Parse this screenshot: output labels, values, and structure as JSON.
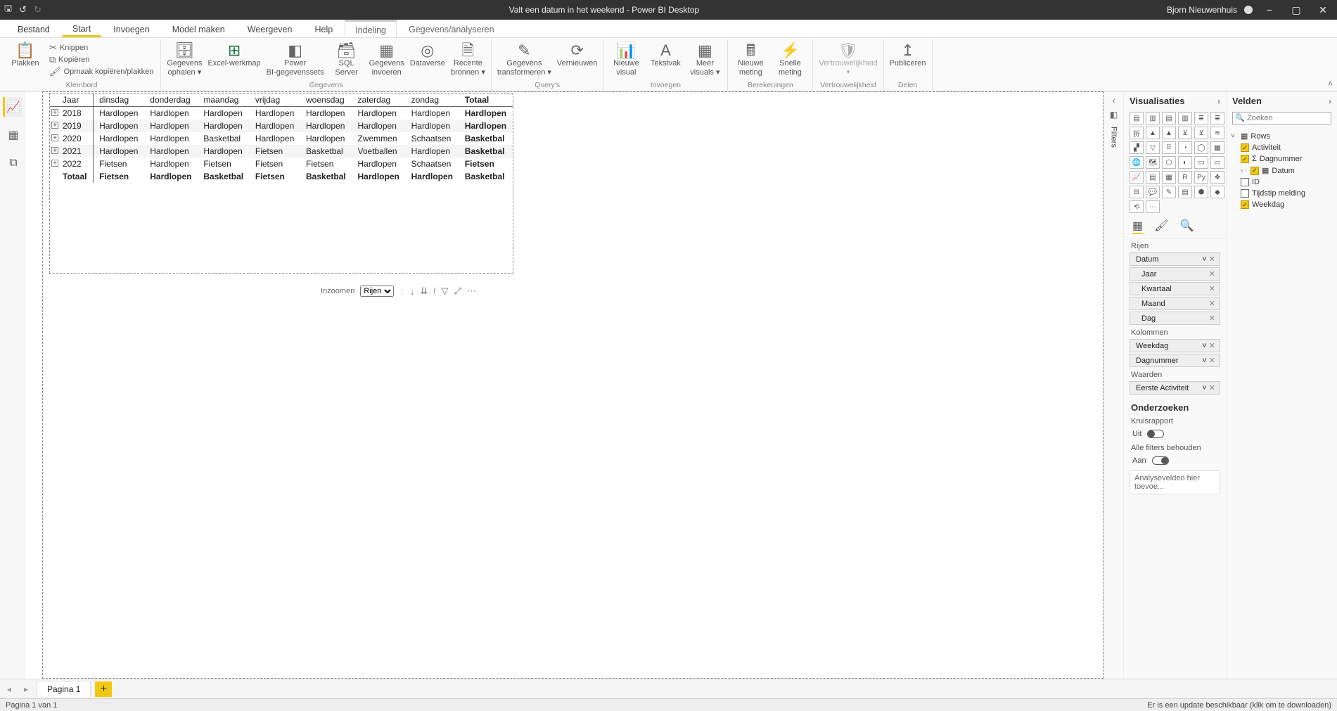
{
  "titlebar": {
    "title": "Valt een datum in het weekend - Power BI Desktop",
    "user": "Bjorn Nieuwenhuis"
  },
  "tabs": {
    "bestand": "Bestand",
    "start": "Start",
    "invoegen": "Invoegen",
    "modelmaken": "Model maken",
    "weergeven": "Weergeven",
    "help": "Help",
    "indeling": "Indeling",
    "gegevens": "Gegevens/analyseren"
  },
  "ribbon": {
    "plakken": "Plakken",
    "knippen": "Knippen",
    "kopieren": "Kopiëren",
    "opmaak": "Opmaak kopiëren/plakken",
    "klembord": "Klembord",
    "gegevens_ophalen": "Gegevens\nophalen ▾",
    "excel": "Excel-werkmap",
    "pbi_sets": "Power\nBI-gegevenssets",
    "sql": "SQL\nServer",
    "invoeren": "Gegevens\ninvoeren",
    "dataverse": "Dataverse",
    "recente": "Recente\nbronnen ▾",
    "gegevens_group": "Gegevens",
    "transformeren": "Gegevens\ntransformeren ▾",
    "vernieuwen": "Vernieuwen",
    "querys": "Query's",
    "nieuwe_visual": "Nieuwe\nvisual",
    "tekstvak": "Tekstvak",
    "meer_visuals": "Meer\nvisuals ▾",
    "invoegen_group": "Invoegen",
    "nieuwe_meting": "Nieuwe\nmeting",
    "snelle_meting": "Snelle\nmeting",
    "berekeningen": "Berekeningen",
    "vertrouwelijkheid": "Vertrouwelijkheid",
    "vertrouwelijkheid_group": "Vertrouwelijkheid",
    "publiceren": "Publiceren",
    "delen": "Delen"
  },
  "matrix": {
    "header_year": "Jaar",
    "columns": [
      "dinsdag",
      "donderdag",
      "maandag",
      "vrijdag",
      "woensdag",
      "zaterdag",
      "zondag",
      "Totaal"
    ],
    "rows": [
      {
        "year": "2018",
        "cells": [
          "Hardlopen",
          "Hardlopen",
          "Hardlopen",
          "Hardlopen",
          "Hardlopen",
          "Hardlopen",
          "Hardlopen",
          "Hardlopen"
        ]
      },
      {
        "year": "2019",
        "cells": [
          "Hardlopen",
          "Hardlopen",
          "Hardlopen",
          "Hardlopen",
          "Hardlopen",
          "Hardlopen",
          "Hardlopen",
          "Hardlopen"
        ]
      },
      {
        "year": "2020",
        "cells": [
          "Hardlopen",
          "Hardlopen",
          "Basketbal",
          "Hardlopen",
          "Hardlopen",
          "Zwemmen",
          "Schaatsen",
          "Basketbal"
        ]
      },
      {
        "year": "2021",
        "cells": [
          "Hardlopen",
          "Hardlopen",
          "Hardlopen",
          "Fietsen",
          "Basketbal",
          "Voetballen",
          "Hardlopen",
          "Basketbal"
        ]
      },
      {
        "year": "2022",
        "cells": [
          "Fietsen",
          "Hardlopen",
          "Fietsen",
          "Fietsen",
          "Fietsen",
          "Hardlopen",
          "Schaatsen",
          "Fietsen"
        ]
      }
    ],
    "total_label": "Totaal",
    "totals": [
      "Fietsen",
      "Hardlopen",
      "Basketbal",
      "Fietsen",
      "Basketbal",
      "Hardlopen",
      "Hardlopen",
      "Basketbal"
    ]
  },
  "visual_toolbar": {
    "inzoomen": "Inzoomen",
    "select": "Rijen"
  },
  "filters_label": "Filters",
  "vispane": {
    "title": "Visualisaties",
    "rijen": "Rijen",
    "kolommen": "Kolommen",
    "waarden": "Waarden",
    "onderzoeken": "Onderzoeken",
    "kruisrapport": "Kruisrapport",
    "uit": "Uit",
    "alle_filters": "Alle filters behouden",
    "aan": "Aan",
    "drill_placeholder": "Analysevelden hier toevoe...",
    "wells": {
      "datum": "Datum",
      "jaar": "Jaar",
      "kwartaal": "Kwartaal",
      "maand": "Maand",
      "dag": "Dag",
      "weekdag": "Weekdag",
      "dagnummer": "Dagnummer",
      "eerste_activiteit": "Eerste Activiteit"
    }
  },
  "fieldspane": {
    "title": "Velden",
    "search_placeholder": "Zoeken",
    "table": "Rows",
    "fields": {
      "activiteit": "Activiteit",
      "dagnummer": "Dagnummer",
      "datum": "Datum",
      "id": "ID",
      "tijdstip": "Tijdstip melding",
      "weekdag": "Weekdag"
    }
  },
  "pagetab": {
    "pagina1": "Pagina 1"
  },
  "status": {
    "left": "Pagina 1 van 1",
    "right": "Er is een update beschikbaar (klik om te downloaden)"
  }
}
